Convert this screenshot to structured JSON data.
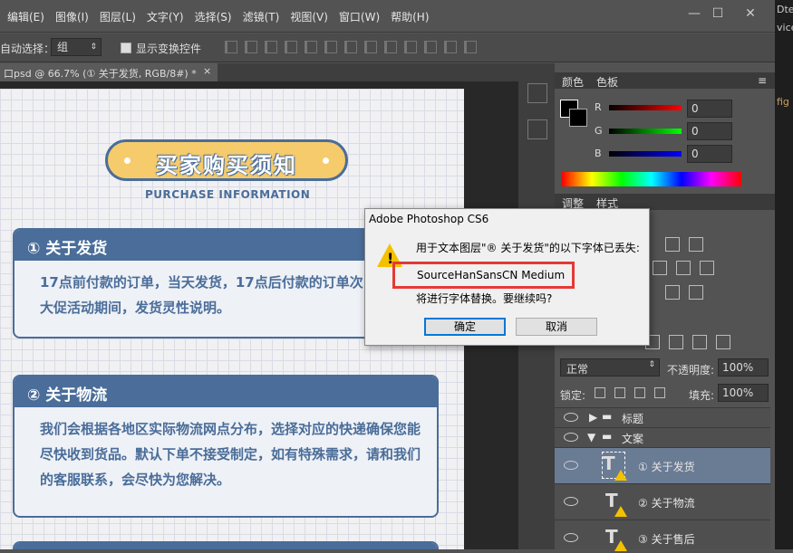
{
  "menu": [
    "编辑(E)",
    "图像(I)",
    "图层(L)",
    "文字(Y)",
    "选择(S)",
    "滤镜(T)",
    "视图(V)",
    "窗口(W)",
    "帮助(H)"
  ],
  "window_controls": {
    "minimize": "—",
    "restore": "☐",
    "close": "✕"
  },
  "options": {
    "auto_select_label": "自动选择：",
    "auto_select_value": "组",
    "show_transform_label": "显示变换控件"
  },
  "doc_tab": {
    "title": "口psd @ 66.7% (① 关于发货, RGB/8#) *",
    "close": "×"
  },
  "document": {
    "title": "买家购买须知",
    "subtitle": "PURCHASE INFORMATION",
    "sections": [
      {
        "heading": "① 关于发货",
        "body": "17点前付款的订单，当天发货，17点后付款的订单次日发货，大促活动期间，发货灵性说明。"
      },
      {
        "heading": "② 关于物流",
        "body": "我们会根据各地区实际物流网点分布，选择对应的快递确保您能尽快收到货品。默认下单不接受制定，如有特殊需求，请和我们的客服联系，会尽快为您解决。"
      }
    ]
  },
  "color_panel": {
    "tabs": [
      "颜色",
      "色板"
    ],
    "channels": [
      {
        "label": "R",
        "value": "0",
        "color": "#e02020"
      },
      {
        "label": "G",
        "value": "0",
        "color": "#20c020"
      },
      {
        "label": "B",
        "value": "0",
        "color": "#2040e0"
      }
    ]
  },
  "adjust_panel": {
    "tabs": [
      "调整",
      "样式"
    ]
  },
  "layers_panel": {
    "blend_mode": "正常",
    "opacity_label": "不透明度:",
    "opacity_value": "100%",
    "lock_label": "锁定:",
    "fill_label": "填充:",
    "fill_value": "100%",
    "layers": [
      {
        "name": "标题",
        "type": "group",
        "expanded": false
      },
      {
        "name": "文案",
        "type": "group",
        "expanded": true
      },
      {
        "name": "① 关于发货",
        "type": "text",
        "selected": true
      },
      {
        "name": "② 关于物流",
        "type": "text",
        "selected": false
      },
      {
        "name": "③ 关于售后",
        "type": "text",
        "selected": false
      }
    ]
  },
  "right_strip": {
    "line1": "Dte",
    "line2": "vice",
    "line3": "fig"
  },
  "dialog": {
    "title": "Adobe Photoshop CS6",
    "message": "用于文本图层\"® 关于发货\"的以下字体已丢失:",
    "font_name": "SourceHanSansCN Medium",
    "question": "将进行字体替换。要继续吗?",
    "ok_label": "确定",
    "cancel_label": "取消"
  }
}
